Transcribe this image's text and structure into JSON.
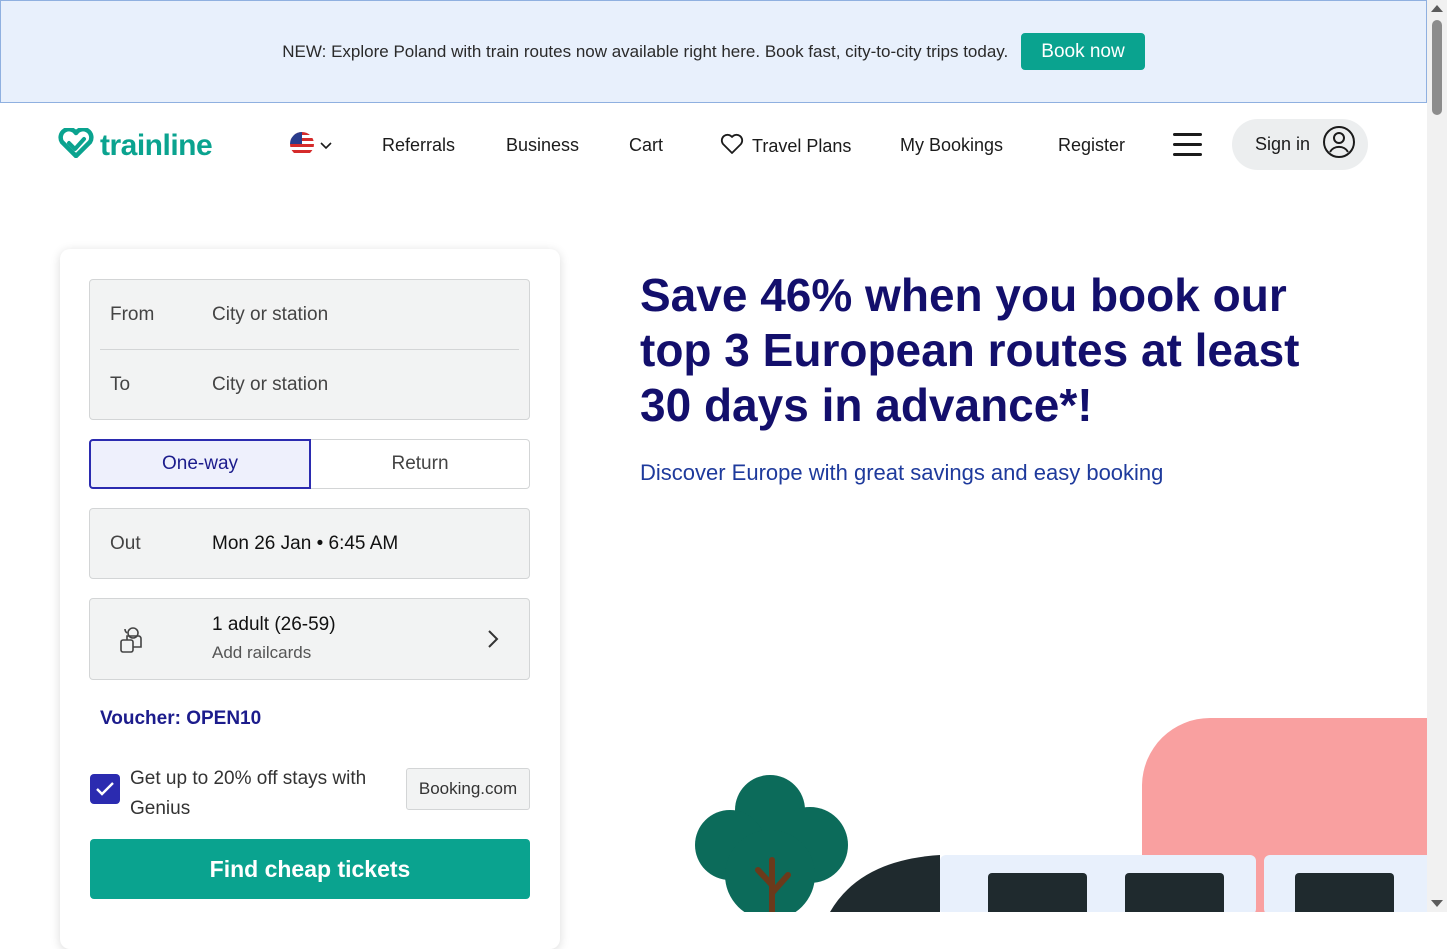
{
  "banner": {
    "text": "NEW: Explore Poland with train routes now available right here. Book fast, city-to-city trips today.",
    "button_label": "Book now"
  },
  "header": {
    "logo_text": "trainline",
    "nav": {
      "referrals": "Referrals",
      "business": "Business",
      "cart": "Cart",
      "travel_plans": "Travel Plans",
      "my_bookings": "My Bookings",
      "register": "Register"
    },
    "sign_in": "Sign in"
  },
  "search": {
    "from_label": "From",
    "from_placeholder": "City or station",
    "to_label": "To",
    "to_placeholder": "City or station",
    "trip_types": [
      "One-way",
      "Return"
    ],
    "selected_trip": "One-way",
    "out_label": "Out",
    "out_value": "Mon 26 Jan • 6:45 AM",
    "passengers": "1 adult (26-59)",
    "railcards": "Add railcards",
    "voucher": "Voucher: OPEN10",
    "genius_text": "Get up to 20% off stays with Genius",
    "genius_checked": true,
    "booking_badge": "Booking.com",
    "find_button": "Find cheap tickets"
  },
  "hero": {
    "title": "Save 46% when you book our top 3 European routes at least 30 days in advance*!",
    "subtitle": "Discover Europe with great savings and easy booking"
  },
  "colors": {
    "brand": "#0aa38f",
    "navy": "#130f6c",
    "accent_blue": "#2b2bb0",
    "banner_bg": "#e8f0fc"
  }
}
